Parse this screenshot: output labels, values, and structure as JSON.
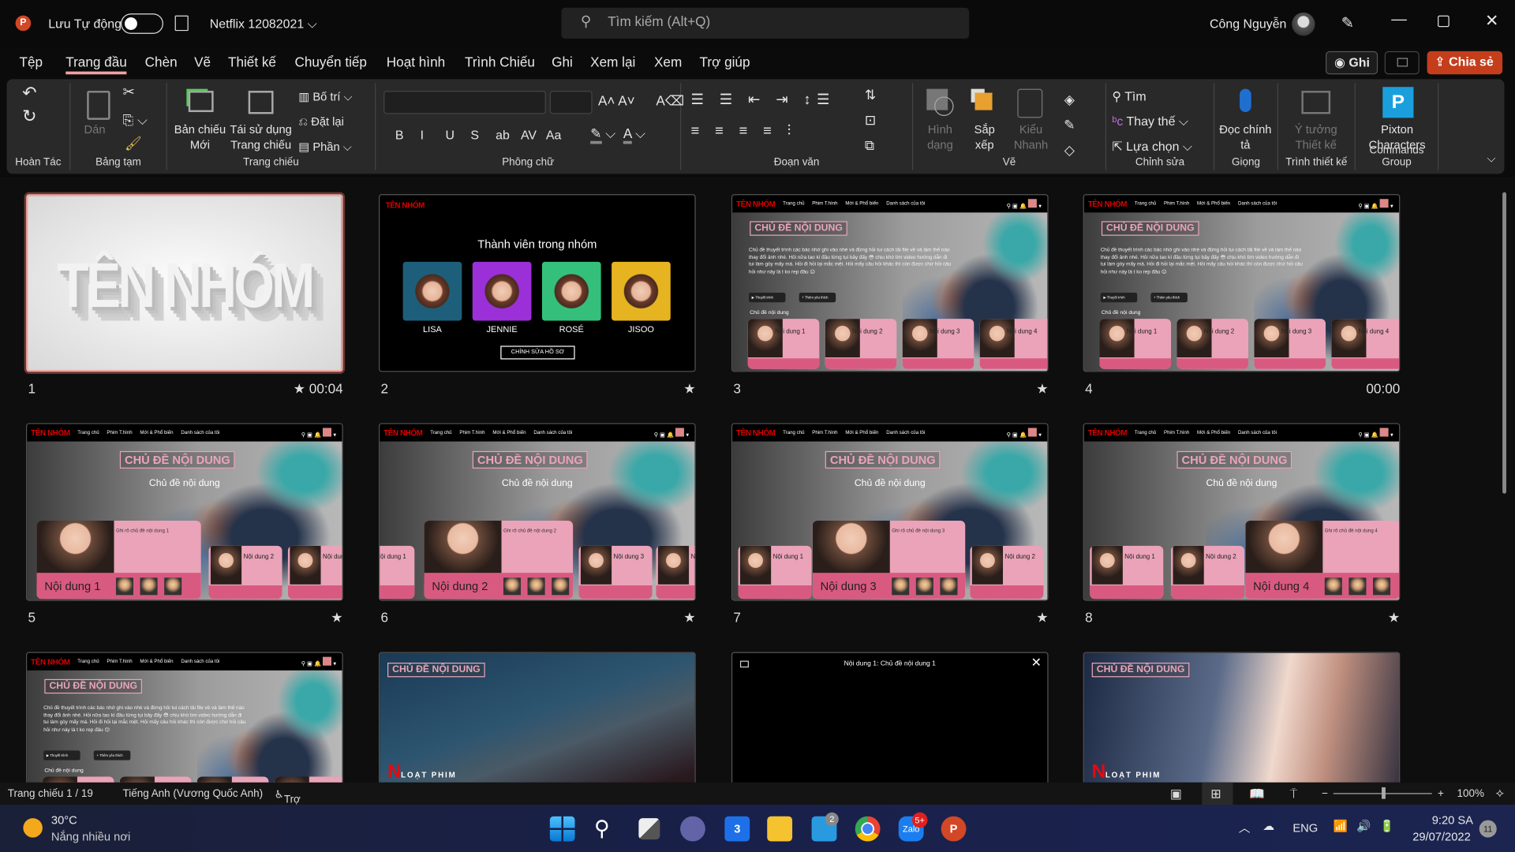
{
  "app": {
    "autosave_label": "Lưu Tự động",
    "autosave_on": false,
    "doc_title": "Netflix 12082021",
    "search_placeholder": "Tìm kiếm (Alt+Q)",
    "user_name": "Công Nguyễn"
  },
  "menu": {
    "tabs": [
      "Tệp",
      "Trang đầu",
      "Chèn",
      "Vẽ",
      "Thiết kế",
      "Chuyển tiếp",
      "Hoạt hình",
      "Trình Chiếu",
      "Ghi",
      "Xem lại",
      "Xem",
      "Trợ giúp"
    ],
    "active": "Trang đầu",
    "record_label": "Ghi",
    "share_label": "Chia sẻ"
  },
  "ribbon": {
    "groups": [
      "Hoàn Tác",
      "Bảng tạm",
      "Trang chiếu",
      "Phông chữ",
      "Đoạn văn",
      "Vẽ",
      "Chỉnh sửa",
      "Giọng",
      "Trình thiết kế",
      "Commands Group"
    ],
    "paste": "Dán",
    "new_slide": "Bản chiếu Mới",
    "reuse_slides": "Tái sử dụng Trang chiếu",
    "layout": "Bố trí",
    "reset": "Đặt lại",
    "section": "Phần",
    "shapes": "Hình dạng",
    "arrange": "Sắp xếp",
    "quick_styles": "Kiểu Nhanh",
    "find": "Tìm",
    "replace": "Thay thế",
    "select": "Lựa chọn",
    "dictate": "Đọc chính tả",
    "design_ideas": "Ý tưởng Thiết kế",
    "pixton": "Pixton Characters",
    "font_buttons": [
      "B",
      "I",
      "U",
      "S",
      "ab",
      "AV",
      "Aa"
    ]
  },
  "slides": [
    {
      "n": "1",
      "type": "title",
      "title": "TÊN NHÓM",
      "star": true,
      "time": "00:04",
      "selected": true
    },
    {
      "n": "2",
      "type": "members",
      "logo": "TÊN NHÓM",
      "heading": "Thành viên trong nhóm",
      "members": [
        "LISA",
        "JENNIE",
        "ROSÉ",
        "JISOO"
      ],
      "button": "CHỈNH SỬA HỒ SƠ",
      "star": true,
      "time": ""
    },
    {
      "n": "3",
      "type": "home",
      "star": true,
      "time": ""
    },
    {
      "n": "4",
      "type": "home",
      "star": false,
      "time": "00:00"
    },
    {
      "n": "5",
      "type": "detail",
      "idx": 1,
      "star": true,
      "time": ""
    },
    {
      "n": "6",
      "type": "detail",
      "idx": 2,
      "star": true,
      "time": ""
    },
    {
      "n": "7",
      "type": "detail",
      "idx": 3,
      "star": true,
      "time": ""
    },
    {
      "n": "8",
      "type": "detail",
      "idx": 4,
      "star": true,
      "time": ""
    },
    {
      "n": "9",
      "type": "home",
      "star": false,
      "time": ""
    },
    {
      "n": "10",
      "type": "video",
      "star": false,
      "time": ""
    },
    {
      "n": "11",
      "type": "player",
      "caption": "Nội dung 1: Chủ đề nội dung 1",
      "star": false,
      "time": ""
    },
    {
      "n": "12",
      "type": "video",
      "star": false,
      "time": ""
    }
  ],
  "nf": {
    "logo": "TÊN NHÓM",
    "nav": [
      "Trang chủ",
      "Phim T.hình",
      "Mới & Phổ biến",
      "Danh sách của tôi"
    ],
    "topic": "CHỦ ĐỀ NỘI DUNG",
    "subtitle": "Chủ đề nội dung",
    "section": "Chủ đề nội dung",
    "body": "Chủ đề thuyết trình các bác nhớ ghi vào nhé và đừng hỏi tui cách tải file về và làm thế nào thay đổi ảnh nhé. Hỏi nữa tao kí đầu từng tụi bây đấy 😳 chịu khó tìm video hướng dẫn đi tui làm gòy mấy má. Hỏi đi hỏi lại mắc mệt. Hỏi mấy câu hỏi khác thì còn được chứ hỏi câu hỏi như này là t ko rep đâu 😑",
    "play": "Thuyết trình",
    "add": "Thêm yêu thích",
    "cards": [
      "Nội dung 1",
      "Nội dung 2",
      "Nội dung 3",
      "Nội dung 4"
    ],
    "notes": [
      "Ghi rõ chủ đề nội dung 1",
      "Ghi rõ chủ đề nội dung 2",
      "Ghi rõ chủ đề nội dung 3",
      "Ghi rõ chủ đề nội dung 4"
    ],
    "series": "LOẠT PHIM"
  },
  "status": {
    "slide": "Trang chiếu 1 / 19",
    "language": "Tiếng Anh (Vương Quốc Anh)",
    "accessibility": "Trợ năng: Cần điều tra",
    "zoom": "100%",
    "zoom_percent": 100
  },
  "taskbar": {
    "temp": "30°C",
    "weather": "Nắng nhiều nơi",
    "mail_badge": "2",
    "zalo_badge": "5+",
    "lang": "ENG",
    "time": "9:20 SA",
    "date": "29/07/2022",
    "notif": "11"
  },
  "colors": {
    "accent": "#c43e1c",
    "pink": "#eaa3b8",
    "pink_dark": "#d95a80",
    "netflix_red": "#d00000"
  }
}
